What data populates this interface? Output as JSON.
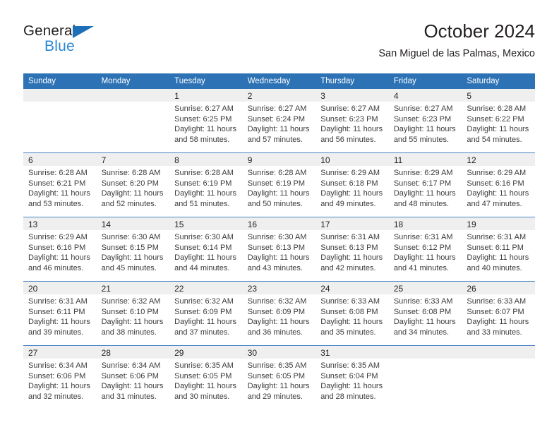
{
  "brand": {
    "name_part1": "General",
    "name_part2": "Blue",
    "colors": {
      "black": "#231f20",
      "blue": "#2b87d4",
      "triangle": "#1f6fb8"
    }
  },
  "header": {
    "title": "October 2024",
    "subtitle": "San Miguel de las Palmas, Mexico"
  },
  "theme": {
    "header_blue": "#2d72b5",
    "row_divider_blue": "#4a86c5",
    "daynum_band": "#efefef"
  },
  "weekday_headers": [
    "Sunday",
    "Monday",
    "Tuesday",
    "Wednesday",
    "Thursday",
    "Friday",
    "Saturday"
  ],
  "labels": {
    "sunrise_prefix": "Sunrise:",
    "sunset_prefix": "Sunset:",
    "daylight_prefix": "Daylight:"
  },
  "weeks": [
    [
      {
        "day": "",
        "empty": true
      },
      {
        "day": "",
        "empty": true
      },
      {
        "day": "1",
        "sunrise": "Sunrise: 6:27 AM",
        "sunset": "Sunset: 6:25 PM",
        "daylight1": "Daylight: 11 hours",
        "daylight2": "and 58 minutes."
      },
      {
        "day": "2",
        "sunrise": "Sunrise: 6:27 AM",
        "sunset": "Sunset: 6:24 PM",
        "daylight1": "Daylight: 11 hours",
        "daylight2": "and 57 minutes."
      },
      {
        "day": "3",
        "sunrise": "Sunrise: 6:27 AM",
        "sunset": "Sunset: 6:23 PM",
        "daylight1": "Daylight: 11 hours",
        "daylight2": "and 56 minutes."
      },
      {
        "day": "4",
        "sunrise": "Sunrise: 6:27 AM",
        "sunset": "Sunset: 6:23 PM",
        "daylight1": "Daylight: 11 hours",
        "daylight2": "and 55 minutes."
      },
      {
        "day": "5",
        "sunrise": "Sunrise: 6:28 AM",
        "sunset": "Sunset: 6:22 PM",
        "daylight1": "Daylight: 11 hours",
        "daylight2": "and 54 minutes."
      }
    ],
    [
      {
        "day": "6",
        "sunrise": "Sunrise: 6:28 AM",
        "sunset": "Sunset: 6:21 PM",
        "daylight1": "Daylight: 11 hours",
        "daylight2": "and 53 minutes."
      },
      {
        "day": "7",
        "sunrise": "Sunrise: 6:28 AM",
        "sunset": "Sunset: 6:20 PM",
        "daylight1": "Daylight: 11 hours",
        "daylight2": "and 52 minutes."
      },
      {
        "day": "8",
        "sunrise": "Sunrise: 6:28 AM",
        "sunset": "Sunset: 6:19 PM",
        "daylight1": "Daylight: 11 hours",
        "daylight2": "and 51 minutes."
      },
      {
        "day": "9",
        "sunrise": "Sunrise: 6:28 AM",
        "sunset": "Sunset: 6:19 PM",
        "daylight1": "Daylight: 11 hours",
        "daylight2": "and 50 minutes."
      },
      {
        "day": "10",
        "sunrise": "Sunrise: 6:29 AM",
        "sunset": "Sunset: 6:18 PM",
        "daylight1": "Daylight: 11 hours",
        "daylight2": "and 49 minutes."
      },
      {
        "day": "11",
        "sunrise": "Sunrise: 6:29 AM",
        "sunset": "Sunset: 6:17 PM",
        "daylight1": "Daylight: 11 hours",
        "daylight2": "and 48 minutes."
      },
      {
        "day": "12",
        "sunrise": "Sunrise: 6:29 AM",
        "sunset": "Sunset: 6:16 PM",
        "daylight1": "Daylight: 11 hours",
        "daylight2": "and 47 minutes."
      }
    ],
    [
      {
        "day": "13",
        "sunrise": "Sunrise: 6:29 AM",
        "sunset": "Sunset: 6:16 PM",
        "daylight1": "Daylight: 11 hours",
        "daylight2": "and 46 minutes."
      },
      {
        "day": "14",
        "sunrise": "Sunrise: 6:30 AM",
        "sunset": "Sunset: 6:15 PM",
        "daylight1": "Daylight: 11 hours",
        "daylight2": "and 45 minutes."
      },
      {
        "day": "15",
        "sunrise": "Sunrise: 6:30 AM",
        "sunset": "Sunset: 6:14 PM",
        "daylight1": "Daylight: 11 hours",
        "daylight2": "and 44 minutes."
      },
      {
        "day": "16",
        "sunrise": "Sunrise: 6:30 AM",
        "sunset": "Sunset: 6:13 PM",
        "daylight1": "Daylight: 11 hours",
        "daylight2": "and 43 minutes."
      },
      {
        "day": "17",
        "sunrise": "Sunrise: 6:31 AM",
        "sunset": "Sunset: 6:13 PM",
        "daylight1": "Daylight: 11 hours",
        "daylight2": "and 42 minutes."
      },
      {
        "day": "18",
        "sunrise": "Sunrise: 6:31 AM",
        "sunset": "Sunset: 6:12 PM",
        "daylight1": "Daylight: 11 hours",
        "daylight2": "and 41 minutes."
      },
      {
        "day": "19",
        "sunrise": "Sunrise: 6:31 AM",
        "sunset": "Sunset: 6:11 PM",
        "daylight1": "Daylight: 11 hours",
        "daylight2": "and 40 minutes."
      }
    ],
    [
      {
        "day": "20",
        "sunrise": "Sunrise: 6:31 AM",
        "sunset": "Sunset: 6:11 PM",
        "daylight1": "Daylight: 11 hours",
        "daylight2": "and 39 minutes."
      },
      {
        "day": "21",
        "sunrise": "Sunrise: 6:32 AM",
        "sunset": "Sunset: 6:10 PM",
        "daylight1": "Daylight: 11 hours",
        "daylight2": "and 38 minutes."
      },
      {
        "day": "22",
        "sunrise": "Sunrise: 6:32 AM",
        "sunset": "Sunset: 6:09 PM",
        "daylight1": "Daylight: 11 hours",
        "daylight2": "and 37 minutes."
      },
      {
        "day": "23",
        "sunrise": "Sunrise: 6:32 AM",
        "sunset": "Sunset: 6:09 PM",
        "daylight1": "Daylight: 11 hours",
        "daylight2": "and 36 minutes."
      },
      {
        "day": "24",
        "sunrise": "Sunrise: 6:33 AM",
        "sunset": "Sunset: 6:08 PM",
        "daylight1": "Daylight: 11 hours",
        "daylight2": "and 35 minutes."
      },
      {
        "day": "25",
        "sunrise": "Sunrise: 6:33 AM",
        "sunset": "Sunset: 6:08 PM",
        "daylight1": "Daylight: 11 hours",
        "daylight2": "and 34 minutes."
      },
      {
        "day": "26",
        "sunrise": "Sunrise: 6:33 AM",
        "sunset": "Sunset: 6:07 PM",
        "daylight1": "Daylight: 11 hours",
        "daylight2": "and 33 minutes."
      }
    ],
    [
      {
        "day": "27",
        "sunrise": "Sunrise: 6:34 AM",
        "sunset": "Sunset: 6:06 PM",
        "daylight1": "Daylight: 11 hours",
        "daylight2": "and 32 minutes."
      },
      {
        "day": "28",
        "sunrise": "Sunrise: 6:34 AM",
        "sunset": "Sunset: 6:06 PM",
        "daylight1": "Daylight: 11 hours",
        "daylight2": "and 31 minutes."
      },
      {
        "day": "29",
        "sunrise": "Sunrise: 6:35 AM",
        "sunset": "Sunset: 6:05 PM",
        "daylight1": "Daylight: 11 hours",
        "daylight2": "and 30 minutes."
      },
      {
        "day": "30",
        "sunrise": "Sunrise: 6:35 AM",
        "sunset": "Sunset: 6:05 PM",
        "daylight1": "Daylight: 11 hours",
        "daylight2": "and 29 minutes."
      },
      {
        "day": "31",
        "sunrise": "Sunrise: 6:35 AM",
        "sunset": "Sunset: 6:04 PM",
        "daylight1": "Daylight: 11 hours",
        "daylight2": "and 28 minutes."
      },
      {
        "day": "",
        "empty": true
      },
      {
        "day": "",
        "empty": true
      }
    ]
  ]
}
